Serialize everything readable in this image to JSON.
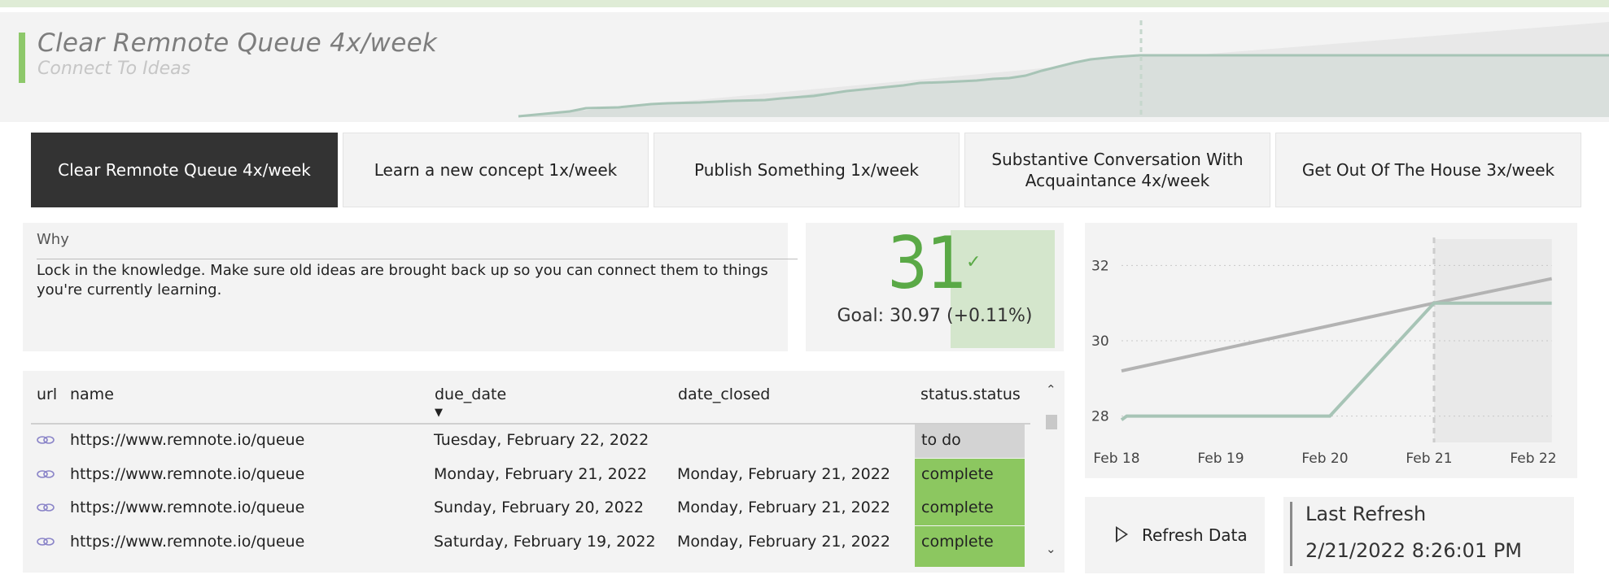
{
  "header": {
    "title": "Clear Remnote Queue 4x/week",
    "subtitle": "Connect To Ideas"
  },
  "tabs": [
    {
      "label": "Clear Remnote Queue 4x/week",
      "active": true
    },
    {
      "label": "Learn a new concept 1x/week",
      "active": false
    },
    {
      "label": "Publish Something 1x/week",
      "active": false
    },
    {
      "label": "Substantive Conversation With Acquaintance 4x/week",
      "active": false
    },
    {
      "label": "Get Out Of The House 3x/week",
      "active": false
    }
  ],
  "why": {
    "label": "Why",
    "text": "Lock in the knowledge. Make sure old ideas are brought back up so you can connect them to things you're currently learning."
  },
  "kpi": {
    "value": "31",
    "goal": "Goal: 30.97 (+0.11%)",
    "status_color": "#5aa946"
  },
  "table": {
    "columns": [
      "url",
      "name",
      "due_date",
      "date_closed",
      "status.status"
    ],
    "sorted_column": "due_date",
    "rows": [
      {
        "name": "https://www.remnote.io/queue",
        "due_date": "Tuesday, February 22, 2022",
        "date_closed": "",
        "status": "to do",
        "status_color": "#d3d3d3"
      },
      {
        "name": "https://www.remnote.io/queue",
        "due_date": "Monday, February 21, 2022",
        "date_closed": "Monday, February 21, 2022",
        "status": "complete",
        "status_color": "#8cc760"
      },
      {
        "name": "https://www.remnote.io/queue",
        "due_date": "Sunday, February 20, 2022",
        "date_closed": "Monday, February 21, 2022",
        "status": "complete",
        "status_color": "#8cc760"
      },
      {
        "name": "https://www.remnote.io/queue",
        "due_date": "Saturday, February 19, 2022",
        "date_closed": "Monday, February 21, 2022",
        "status": "complete",
        "status_color": "#8cc760"
      }
    ]
  },
  "chart_data": {
    "type": "line",
    "x_labels": [
      "Feb 18",
      "Feb 19",
      "Feb 20",
      "Feb 21",
      "Feb 22"
    ],
    "y_ticks": [
      28,
      30,
      32
    ],
    "ylim": [
      27.3,
      32.7
    ],
    "today": "Feb 21",
    "series": [
      {
        "x": [
          0,
          0.05,
          2,
          3,
          4.13
        ],
        "y": [
          27.9,
          28,
          28,
          31,
          31
        ],
        "color": "#a7c4b6"
      },
      {
        "x": [
          0,
          3,
          4.13
        ],
        "y": [
          29.2,
          31,
          31.65
        ],
        "color": "#b3b3b3"
      }
    ]
  },
  "refresh": {
    "label": "Refresh Data"
  },
  "last_refresh": {
    "label": "Last Refresh",
    "value": "2/21/2022 8:26:01 PM"
  }
}
